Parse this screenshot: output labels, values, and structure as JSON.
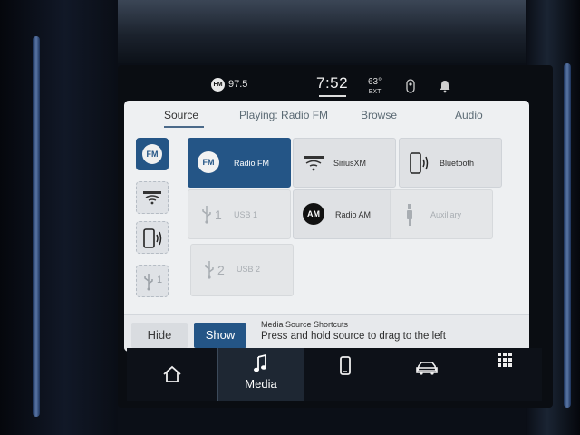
{
  "status": {
    "source_badge": "FM",
    "frequency": "97.5",
    "time": "7:52",
    "temperature": "63°",
    "temperature_label": "EXT",
    "icons": [
      "voice-icon",
      "notification-bell-icon"
    ]
  },
  "tabs": [
    {
      "label": "Source",
      "active": true
    },
    {
      "label": "Playing: Radio FM",
      "active": false
    },
    {
      "label": "Browse",
      "active": false
    },
    {
      "label": "Audio",
      "active": false
    }
  ],
  "shortcuts": [
    {
      "icon": "fm-icon",
      "label": "FM",
      "active": true
    },
    {
      "icon": "siriusxm-icon",
      "label": "",
      "active": false
    },
    {
      "icon": "bluetooth-phone-icon",
      "label": "",
      "active": false
    },
    {
      "icon": "usb-icon",
      "label": "1",
      "active": false
    }
  ],
  "sources": [
    {
      "label": "Radio FM",
      "icon": "fm-icon",
      "badge": "FM",
      "state": "active"
    },
    {
      "label": "SiriusXM",
      "icon": "siriusxm-icon",
      "state": "normal"
    },
    {
      "label": "Bluetooth",
      "icon": "bluetooth-phone-icon",
      "state": "normal"
    },
    {
      "label": "USB 1",
      "icon": "usb-icon",
      "number": "1",
      "state": "disabled"
    },
    {
      "label": "Radio AM",
      "icon": "am-icon",
      "badge": "AM",
      "state": "normal"
    },
    {
      "label": "Auxiliary",
      "icon": "aux-icon",
      "state": "disabled"
    },
    {
      "label": "USB 2",
      "icon": "usb-icon",
      "number": "2",
      "state": "disabled"
    }
  ],
  "shortcut_bar": {
    "hide_label": "Hide",
    "show_label": "Show",
    "title": "Media Source Shortcuts",
    "hint": "Press and hold source to drag to the left"
  },
  "nav": [
    {
      "icon": "home-icon",
      "label": "",
      "active": false
    },
    {
      "icon": "music-note-icon",
      "label": "Media",
      "active": true
    },
    {
      "icon": "phone-icon",
      "label": "",
      "active": false
    },
    {
      "icon": "vehicle-icon",
      "label": "",
      "active": false
    },
    {
      "icon": "apps-grid-icon",
      "label": "",
      "active": false
    }
  ],
  "colors": {
    "accent": "#245586",
    "panel": "#eef0f2",
    "disabled_text": "#a8adb2"
  }
}
